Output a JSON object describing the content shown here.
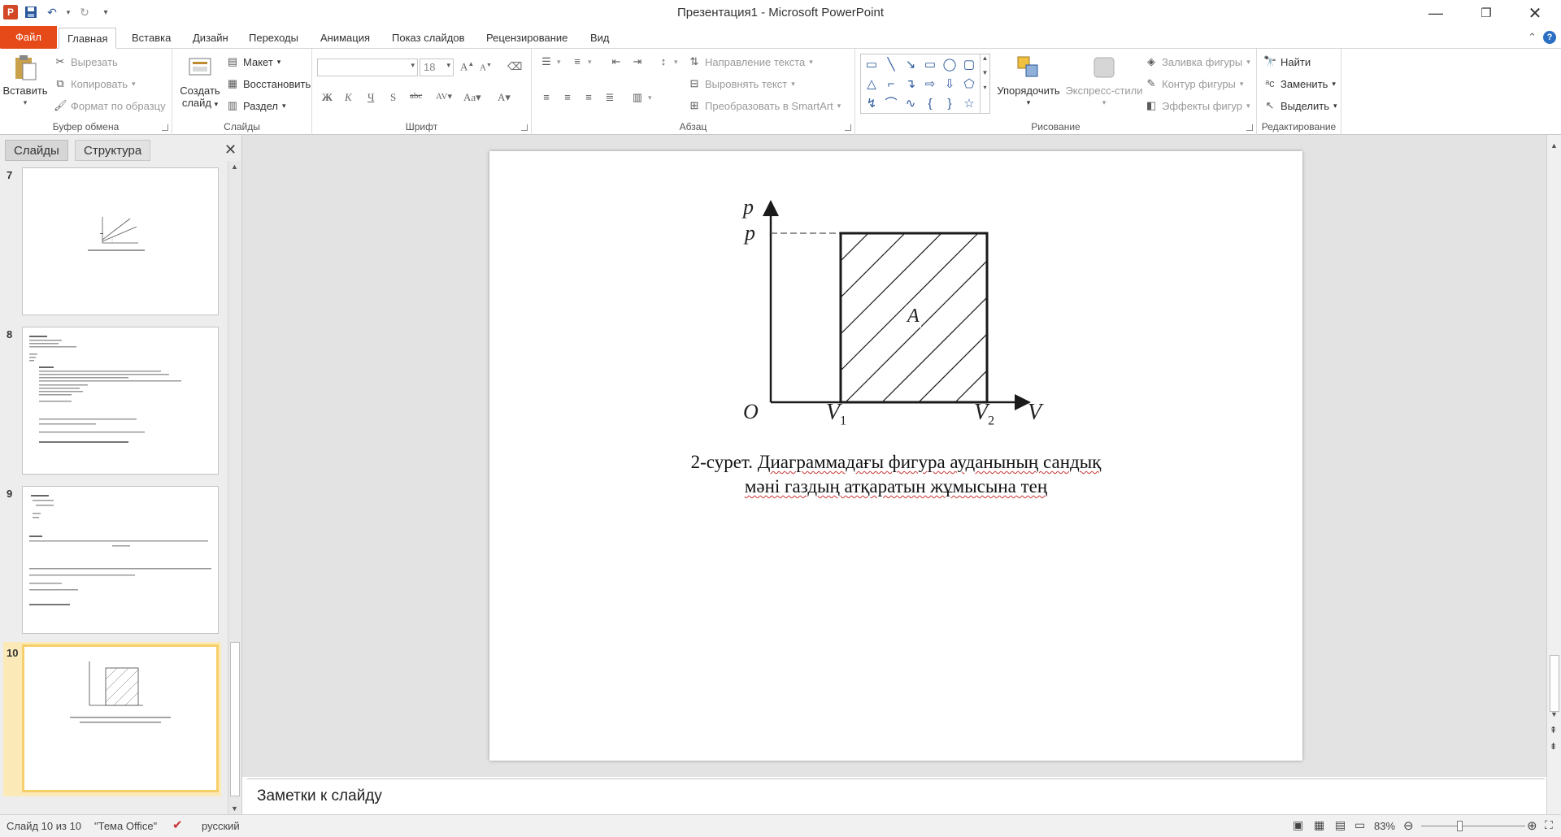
{
  "window": {
    "title": "Презентация1 - Microsoft PowerPoint"
  },
  "tabs": {
    "file": "Файл",
    "items": [
      "Главная",
      "Вставка",
      "Дизайн",
      "Переходы",
      "Анимация",
      "Показ слайдов",
      "Рецензирование",
      "Вид"
    ]
  },
  "ribbon": {
    "clipboard": {
      "label": "Буфер обмена",
      "paste": "Вставить",
      "cut": "Вырезать",
      "copy": "Копировать",
      "format_painter": "Формат по образцу"
    },
    "slides": {
      "label": "Слайды",
      "new_slide_1": "Создать",
      "new_slide_2": "слайд",
      "layout": "Макет",
      "reset": "Восстановить",
      "section": "Раздел"
    },
    "font": {
      "label": "Шрифт",
      "size": "18"
    },
    "paragraph": {
      "label": "Абзац",
      "text_direction": "Направление текста",
      "align_text": "Выровнять текст",
      "smartart": "Преобразовать в SmartArt"
    },
    "drawing": {
      "label": "Рисование",
      "arrange": "Упорядочить",
      "quick_styles": "Экспресс-стили",
      "fill": "Заливка фигуры",
      "outline": "Контур фигуры",
      "effects": "Эффекты фигур"
    },
    "editing": {
      "label": "Редактирование",
      "find": "Найти",
      "replace": "Заменить",
      "select": "Выделить"
    }
  },
  "left_pane": {
    "tab_slides": "Слайды",
    "tab_outline": "Структура",
    "slide_numbers": [
      "7",
      "8",
      "9",
      "10"
    ]
  },
  "slide": {
    "figure": {
      "axis_p": "p",
      "level_p": "p",
      "origin": "O",
      "v1": "V",
      "v1_sub": "1",
      "v2": "V",
      "v2_sub": "2",
      "axis_v": "V",
      "area_label": "A"
    },
    "caption_prefix": "2-сурет.",
    "caption_line1_rest": "Диаграммадағы фигура ауданының сандық",
    "caption_line2": "мәні газдың атқаратын жұмысына тең"
  },
  "notes": {
    "placeholder": "Заметки к слайду"
  },
  "status": {
    "slide_counter": "Слайд 10 из 10",
    "theme": "\"Тема Office\"",
    "language": "русский",
    "zoom": "83%"
  }
}
